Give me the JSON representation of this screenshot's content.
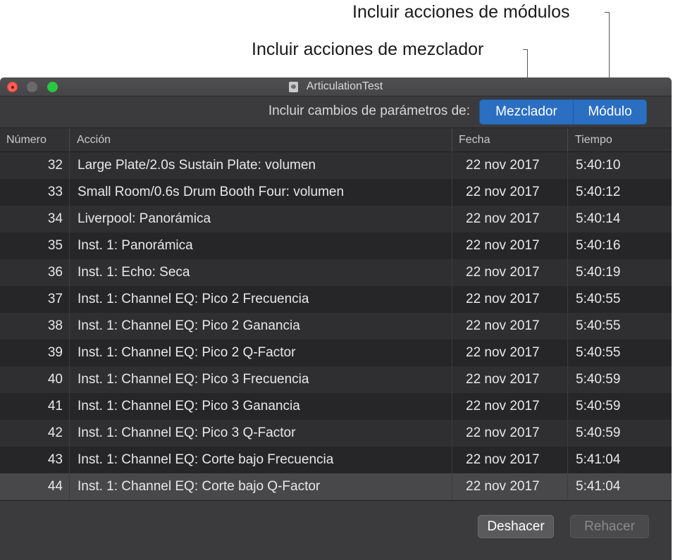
{
  "annotations": {
    "plugins": "Incluir acciones de módulos",
    "mixer": "Incluir acciones de mezclador"
  },
  "window": {
    "title": "ArticulationTest"
  },
  "toolbar": {
    "label": "Incluir cambios de parámetros de:",
    "segments": [
      "Mezclador",
      "Módulo"
    ]
  },
  "table": {
    "columns": [
      "Número",
      "Acción",
      "Fecha",
      "Tiempo"
    ],
    "rows": [
      {
        "num": "32",
        "action": "Large Plate/2.0s Sustain Plate: volumen",
        "date": "22 nov 2017",
        "time": "5:40:10"
      },
      {
        "num": "33",
        "action": "Small Room/0.6s Drum Booth Four: volumen",
        "date": "22 nov 2017",
        "time": "5:40:12"
      },
      {
        "num": "34",
        "action": "Liverpool: Panorámica",
        "date": "22 nov 2017",
        "time": "5:40:14"
      },
      {
        "num": "35",
        "action": "Inst. 1: Panorámica",
        "date": "22 nov 2017",
        "time": "5:40:16"
      },
      {
        "num": "36",
        "action": "Inst. 1: Echo: Seca",
        "date": "22 nov 2017",
        "time": "5:40:19"
      },
      {
        "num": "37",
        "action": "Inst. 1: Channel EQ: Pico 2 Frecuencia",
        "date": "22 nov 2017",
        "time": "5:40:55"
      },
      {
        "num": "38",
        "action": "Inst. 1: Channel EQ: Pico 2 Ganancia",
        "date": "22 nov 2017",
        "time": "5:40:55"
      },
      {
        "num": "39",
        "action": "Inst. 1: Channel EQ: Pico 2 Q-Factor",
        "date": "22 nov 2017",
        "time": "5:40:55"
      },
      {
        "num": "40",
        "action": "Inst. 1: Channel EQ: Pico 3 Frecuencia",
        "date": "22 nov 2017",
        "time": "5:40:59"
      },
      {
        "num": "41",
        "action": "Inst. 1: Channel EQ: Pico 3 Ganancia",
        "date": "22 nov 2017",
        "time": "5:40:59"
      },
      {
        "num": "42",
        "action": "Inst. 1: Channel EQ: Pico 3 Q-Factor",
        "date": "22 nov 2017",
        "time": "5:40:59"
      },
      {
        "num": "43",
        "action": "Inst. 1: Channel EQ: Corte bajo Frecuencia",
        "date": "22 nov 2017",
        "time": "5:41:04"
      },
      {
        "num": "44",
        "action": "Inst. 1: Channel EQ: Corte bajo Q-Factor",
        "date": "22 nov 2017",
        "time": "5:41:04",
        "selected": true
      }
    ]
  },
  "buttons": {
    "undo": "Deshacer",
    "redo": "Rehacer"
  }
}
